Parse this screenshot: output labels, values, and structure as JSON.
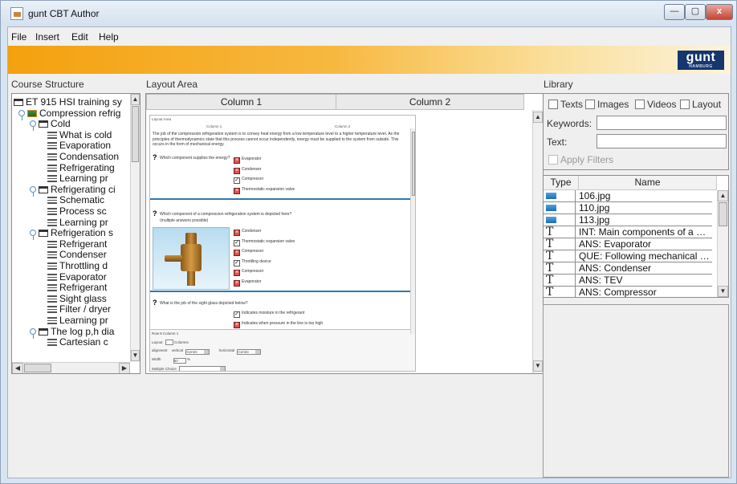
{
  "window": {
    "title": "gunt CBT Author",
    "min_glyph": "—",
    "max_glyph": "▢",
    "close_glyph": "x"
  },
  "menu": [
    "File",
    "Insert",
    "Edit",
    "Help"
  ],
  "banner": {
    "logo_text": "gunt",
    "logo_sub": "HAMBURG",
    "accent": "#f4a10e",
    "logo_color": "#15366e"
  },
  "course_structure": {
    "title": "Course Structure",
    "items": [
      {
        "label": "ET 915 HSI training sy",
        "icon": "folder-icon",
        "level": 0
      },
      {
        "label": "Compression refrig",
        "icon": "book-icon",
        "level": 1,
        "knob": true
      },
      {
        "label": "Cold",
        "icon": "folder-icon",
        "level": 2,
        "knob": true
      },
      {
        "label": "What is cold",
        "icon": "lines-icon",
        "level": 3
      },
      {
        "label": "Evaporation",
        "icon": "lines-icon",
        "level": 3
      },
      {
        "label": "Condensation",
        "icon": "lines-icon",
        "level": 3
      },
      {
        "label": "Refrigerating",
        "icon": "lines-icon",
        "level": 3
      },
      {
        "label": "Learning pr",
        "icon": "lines-icon",
        "level": 3
      },
      {
        "label": "Refrigerating ci",
        "icon": "folder-icon",
        "level": 2,
        "knob": true
      },
      {
        "label": "Schematic",
        "icon": "lines-icon",
        "level": 3
      },
      {
        "label": "Process sc",
        "icon": "lines-icon",
        "level": 3
      },
      {
        "label": "Learning pr",
        "icon": "lines-icon",
        "level": 3
      },
      {
        "label": "Refrigeration s",
        "icon": "folder-icon",
        "level": 2,
        "knob": true
      },
      {
        "label": "Refrigerant",
        "icon": "lines-icon",
        "level": 3
      },
      {
        "label": "Condenser",
        "icon": "lines-icon",
        "level": 3
      },
      {
        "label": "Throttling d",
        "icon": "lines-icon",
        "level": 3
      },
      {
        "label": "Evaporator",
        "icon": "lines-icon",
        "level": 3
      },
      {
        "label": "Refrigerant",
        "icon": "lines-icon",
        "level": 3
      },
      {
        "label": "Sight glass",
        "icon": "lines-icon",
        "level": 3
      },
      {
        "label": "Filter / dryer",
        "icon": "lines-icon",
        "level": 3
      },
      {
        "label": "Learning pr",
        "icon": "lines-icon",
        "level": 3
      },
      {
        "label": "The log p,h dia",
        "icon": "folder-icon",
        "level": 2,
        "knob": true
      },
      {
        "label": "Cartesian c",
        "icon": "lines-icon",
        "level": 3
      }
    ]
  },
  "layout_area": {
    "title": "Layout Area",
    "col1": "Column 1",
    "col2": "Column 2",
    "doc": {
      "mini_title": "Layout Area",
      "mini_col1": "Column 1",
      "mini_col2": "Column 2",
      "intro": "The job of the compression refrigeration system is to convey heat energy from a low temperature level to a higher temperature level. As the principles of thermodynamics state that this process cannot occur independently, energy must be supplied to the system from outside. This occurs in the form of mechanical energy.",
      "q1": "Which component supplies the energy?",
      "q1_answers": [
        {
          "text": "Evaporator",
          "state": "x"
        },
        {
          "text": "Condenser",
          "state": "x"
        },
        {
          "text": "Compressor",
          "state": "check"
        },
        {
          "text": "Thermostatic expansion valve",
          "state": "x"
        }
      ],
      "q2": "Which component of a compression refrigeration system is depicted here?",
      "q2_sub": "(multiple answers possible)",
      "q2_answers": [
        {
          "text": "Condenser",
          "state": "x"
        },
        {
          "text": "Thermostatic expansion valve",
          "state": "check"
        },
        {
          "text": "Compressor",
          "state": "x"
        },
        {
          "text": "Throttling device",
          "state": "check"
        },
        {
          "text": "Compressor",
          "state": "x"
        },
        {
          "text": "Evaporator",
          "state": "x"
        }
      ],
      "q3": "What is the job of the sight glass depicted below?",
      "q3_answers": [
        {
          "text": "Indicates moisture in the refrigerant",
          "state": "check"
        },
        {
          "text": "Indicates when pressure in the line is too high",
          "state": "x"
        }
      ],
      "props": {
        "row_label": "Row 8 Column 1",
        "layout_label": "Layout",
        "columns_label": "Columns",
        "alignment_label": "alignment",
        "vertical_label": "vertical",
        "vertical_value": "Centre",
        "horizontal_label": "horizontal",
        "horizontal_value": "Centre",
        "width_label": "Width",
        "width_value": "50",
        "width_unit": "%",
        "multiple_choice_label": "Multiple Choice"
      }
    }
  },
  "library": {
    "title": "Library",
    "filters": [
      "Texts",
      "Images",
      "Videos",
      "Layout"
    ],
    "keywords_label": "Keywords:",
    "text_label": "Text:",
    "apply_filters": "Apply Filters",
    "columns": [
      "Type",
      "Name"
    ],
    "rows": [
      {
        "type": "image",
        "name": "106.jpg"
      },
      {
        "type": "image",
        "name": "110.jpg"
      },
      {
        "type": "image",
        "name": "113.jpg"
      },
      {
        "type": "text",
        "name": "INT: Main components of a comp..."
      },
      {
        "type": "text",
        "name": "ANS: Evaporator"
      },
      {
        "type": "text",
        "name": "QUE: Following mechanical ener..."
      },
      {
        "type": "text",
        "name": "ANS: Condenser"
      },
      {
        "type": "text",
        "name": "ANS: TEV"
      },
      {
        "type": "text",
        "name": "ANS: Compressor"
      }
    ]
  }
}
